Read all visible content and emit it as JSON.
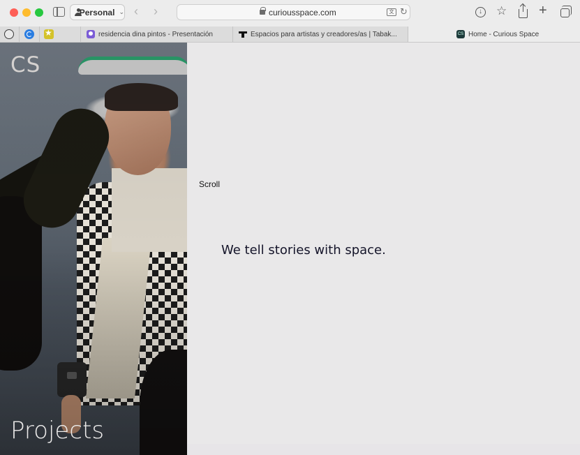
{
  "browser": {
    "profile_label": "Personal",
    "address_url": "curiousspace.com",
    "nav_back_glyph": "‹",
    "nav_forward_glyph": "›",
    "reload_glyph": "↻",
    "star_glyph": "☆",
    "plus_glyph": "+",
    "download_glyph": "↓",
    "translate_glyph": "文",
    "profile_chevron": "⌄",
    "icons": [
      "close-window-icon",
      "minimize-window-icon",
      "zoom-window-icon",
      "sidebar-icon",
      "person-icon",
      "back-icon",
      "forward-icon",
      "lock-icon",
      "translate-icon",
      "reload-icon",
      "download-icon",
      "bookmark-star-icon",
      "share-icon",
      "new-tab-icon",
      "tab-overview-icon"
    ]
  },
  "tabs": {
    "pinned": [
      "pinned-tab-1",
      "pinned-tab-2",
      "pinned-tab-3"
    ],
    "items": [
      {
        "title": "residencia dina pintos - Presentación",
        "active": false
      },
      {
        "title": "Espacios para artistas y creadores/as | Tabak...",
        "active": false
      },
      {
        "title": "Home - Curious Space",
        "active": true
      }
    ],
    "favicon_3_text": "CS"
  },
  "page": {
    "logo_text": "CS",
    "projects_label": "Projects",
    "scroll_label": "Scroll",
    "tagline": "We tell stories with space."
  },
  "colors": {
    "page_background": "#e9e8e9",
    "tagline_color": "#15152a",
    "chrome_background": "#ececec"
  }
}
